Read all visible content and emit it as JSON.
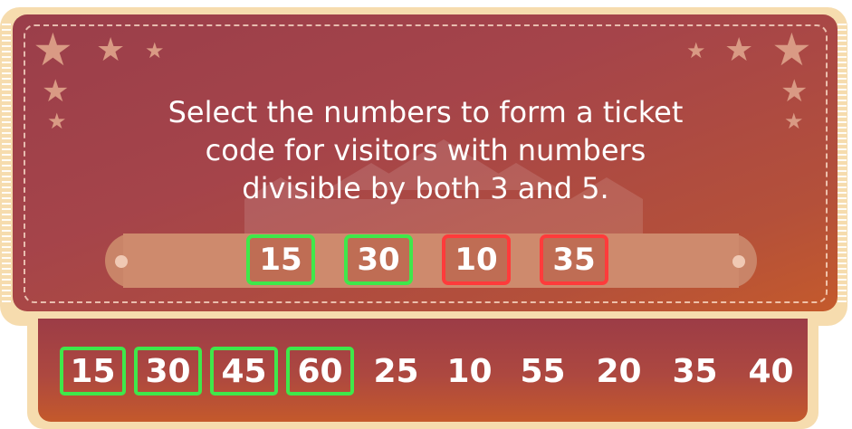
{
  "question": {
    "line1": "Select the numbers to form a ticket",
    "line2": "code for visitors with numbers",
    "line3": "divisible by both 3 and 5."
  },
  "answer_slots": [
    {
      "value": "15",
      "status": "correct"
    },
    {
      "value": "30",
      "status": "correct"
    },
    {
      "value": "10",
      "status": "wrong"
    },
    {
      "value": "35",
      "status": "wrong"
    }
  ],
  "number_choices": [
    {
      "value": "15",
      "selected": true
    },
    {
      "value": "30",
      "selected": true
    },
    {
      "value": "45",
      "selected": true
    },
    {
      "value": "60",
      "selected": true
    },
    {
      "value": "25",
      "selected": false
    },
    {
      "value": "10",
      "selected": false
    },
    {
      "value": "55",
      "selected": false
    },
    {
      "value": "20",
      "selected": false
    },
    {
      "value": "35",
      "selected": false
    },
    {
      "value": "40",
      "selected": false
    }
  ],
  "decorations": {
    "star_icon": "star-icon",
    "background_icon": "circus-tent-icon"
  },
  "colors": {
    "correct_outline": "#3fe84a",
    "wrong_outline": "#ff3b3b",
    "ticket_frame": "#f6dcae",
    "ticket_body": "#a5444a",
    "text": "#ffffff"
  }
}
